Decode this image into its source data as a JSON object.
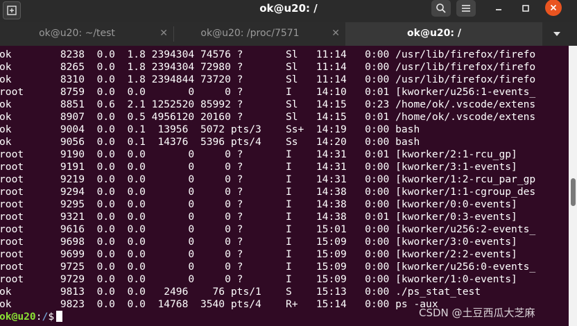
{
  "window": {
    "title": "ok@u20: /",
    "icons": {
      "new_tab": "new-tab-icon",
      "search": "search-icon",
      "menu": "hamburger-menu-icon",
      "minimize": "minimize-icon",
      "maximize": "maximize-icon",
      "close": "close-icon"
    }
  },
  "tabs": [
    {
      "label": "ok@u20: ~/test",
      "active": false
    },
    {
      "label": "ok@u20: /proc/7571",
      "active": false
    },
    {
      "label": "ok@u20: /",
      "active": true
    }
  ],
  "terminal": {
    "lines": [
      "ok        8238  0.0  1.8 2394304 74576 ?       Sl   11:14   0:00 /usr/lib/firefox/firefo",
      "ok        8265  0.0  1.8 2394304 72980 ?       Sl   11:14   0:00 /usr/lib/firefox/firefo",
      "ok        8310  0.0  1.8 2394844 73720 ?       Sl   11:14   0:00 /usr/lib/firefox/firefo",
      "root      8759  0.0  0.0       0     0 ?       I    14:10   0:01 [kworker/u256:1-events_",
      "ok        8851  0.6  2.1 1252520 85992 ?       Sl   14:15   0:23 /home/ok/.vscode/extens",
      "ok        8907  0.0  0.5 4956120 20160 ?       Sl   14:15   0:01 /home/ok/.vscode/extens",
      "ok        9004  0.0  0.1  13956  5072 pts/3    Ss+  14:19   0:00 bash",
      "ok        9056  0.0  0.1  14376  5396 pts/4    Ss   14:20   0:00 bash",
      "root      9190  0.0  0.0       0     0 ?       I    14:31   0:01 [kworker/2:1-rcu_gp]",
      "root      9191  0.0  0.0       0     0 ?       I    14:31   0:00 [kworker/3:1-events]",
      "root      9219  0.0  0.0       0     0 ?       I    14:31   0:00 [kworker/1:2-rcu_par_gp",
      "root      9294  0.0  0.0       0     0 ?       I    14:38   0:00 [kworker/1:1-cgroup_des",
      "root      9295  0.0  0.0       0     0 ?       I    14:38   0:00 [kworker/0:0-events]",
      "root      9321  0.0  0.0       0     0 ?       I    14:38   0:01 [kworker/0:3-events]",
      "root      9616  0.0  0.0       0     0 ?       I    15:01   0:00 [kworker/u256:2-events_",
      "root      9698  0.0  0.0       0     0 ?       I    15:09   0:00 [kworker/3:0-events]",
      "root      9699  0.0  0.0       0     0 ?       I    15:09   0:00 [kworker/2:2-events]",
      "root      9725  0.0  0.0       0     0 ?       I    15:09   0:00 [kworker/u256:0-events_",
      "root      9729  0.0  0.0       0     0 ?       I    15:09   0:00 [kworker/1:0-events]",
      "ok        9813  0.0  0.0   2496    76 pts/1    S    15:13   0:00 ./ps_stat_test",
      "ok        9823  0.0  0.0  14768  3540 pts/4    R+   15:14   0:00 ps -aux"
    ],
    "prompt": {
      "user_host": "ok@u20",
      "separator": ":",
      "path": "/",
      "symbol": "$"
    }
  },
  "watermark": "CSDN @土豆西瓜大芝麻",
  "colors": {
    "terminal_bg": "#300a24",
    "titlebar_bg": "#2b2b2b",
    "prompt_user": "#8ae234",
    "prompt_path": "#729fcf",
    "close_button": "#e95420"
  }
}
